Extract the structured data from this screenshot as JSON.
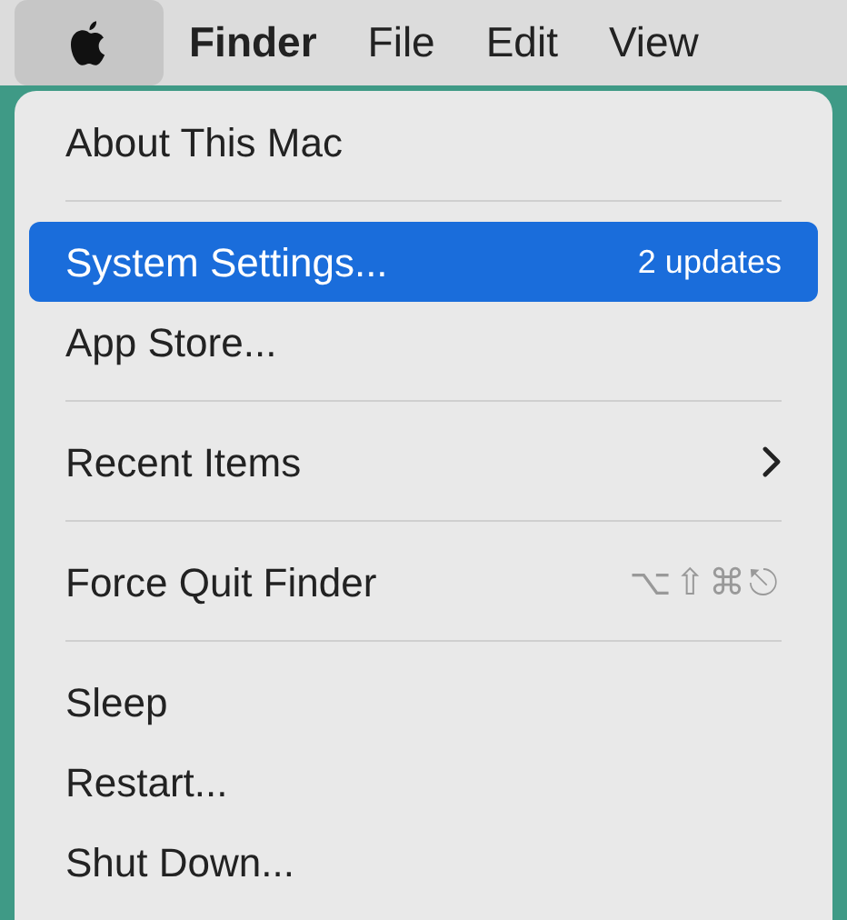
{
  "menu_bar": [
    {
      "kind": "apple",
      "selected": true
    },
    {
      "kind": "app",
      "label": "Finder",
      "selected": false
    },
    {
      "kind": "menu",
      "label": "File",
      "selected": false
    },
    {
      "kind": "menu",
      "label": "Edit",
      "selected": false
    },
    {
      "kind": "menu",
      "label": "View",
      "selected": false
    }
  ],
  "menu": [
    {
      "kind": "item",
      "label": "About This Mac",
      "selected": false
    },
    {
      "kind": "separator"
    },
    {
      "kind": "item",
      "label": "System Settings...",
      "badge": "2 updates",
      "selected": true
    },
    {
      "kind": "item",
      "label": "App Store...",
      "selected": false
    },
    {
      "kind": "separator"
    },
    {
      "kind": "item",
      "label": "Recent Items",
      "submenu": true,
      "selected": false
    },
    {
      "kind": "separator"
    },
    {
      "kind": "item",
      "label": "Force Quit Finder",
      "shortcut": "⌥⇧⌘⎋",
      "selected": false
    },
    {
      "kind": "separator"
    },
    {
      "kind": "item",
      "label": "Sleep",
      "selected": false
    },
    {
      "kind": "item",
      "label": "Restart...",
      "selected": false
    },
    {
      "kind": "item",
      "label": "Shut Down...",
      "selected": false
    }
  ]
}
